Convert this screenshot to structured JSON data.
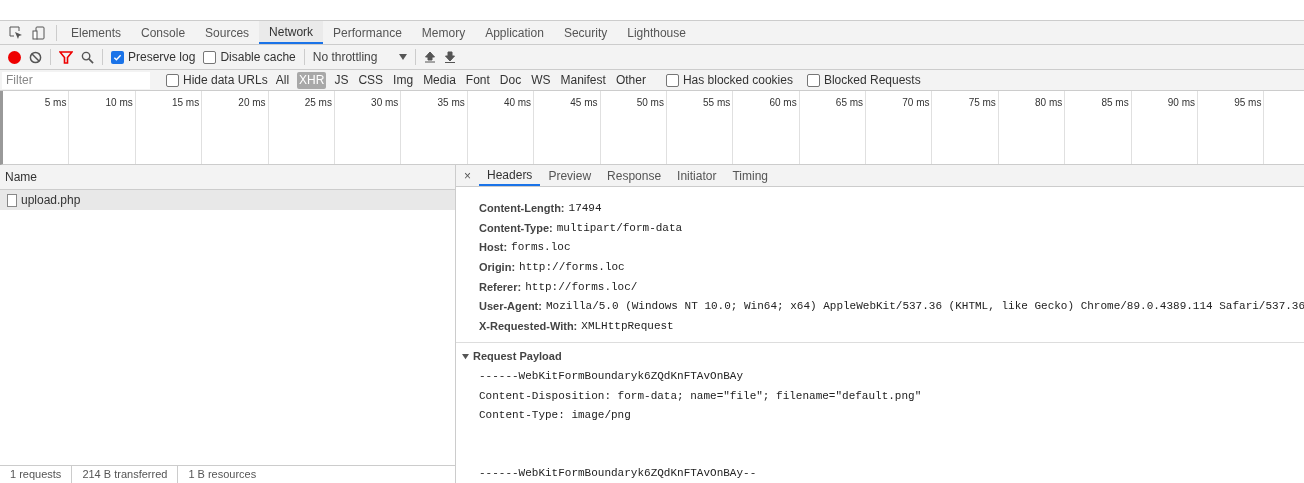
{
  "panel_tabs": [
    {
      "label": "Elements",
      "selected": false
    },
    {
      "label": "Console",
      "selected": false
    },
    {
      "label": "Sources",
      "selected": false
    },
    {
      "label": "Network",
      "selected": true
    },
    {
      "label": "Performance",
      "selected": false
    },
    {
      "label": "Memory",
      "selected": false
    },
    {
      "label": "Application",
      "selected": false
    },
    {
      "label": "Security",
      "selected": false
    },
    {
      "label": "Lighthouse",
      "selected": false
    }
  ],
  "toolbar": {
    "recording": true,
    "preserve_log": {
      "label": "Preserve log",
      "checked": true
    },
    "disable_cache": {
      "label": "Disable cache",
      "checked": false
    },
    "throttling": "No throttling"
  },
  "filter_bar": {
    "placeholder": "Filter",
    "hide_data_urls": {
      "label": "Hide data URLs",
      "checked": false
    },
    "types": [
      {
        "label": "All",
        "selected": false
      },
      {
        "label": "XHR",
        "selected": true
      },
      {
        "label": "JS",
        "selected": false
      },
      {
        "label": "CSS",
        "selected": false
      },
      {
        "label": "Img",
        "selected": false
      },
      {
        "label": "Media",
        "selected": false
      },
      {
        "label": "Font",
        "selected": false
      },
      {
        "label": "Doc",
        "selected": false
      },
      {
        "label": "WS",
        "selected": false
      },
      {
        "label": "Manifest",
        "selected": false
      },
      {
        "label": "Other",
        "selected": false
      }
    ],
    "has_blocked_cookies": {
      "label": "Has blocked cookies",
      "checked": false
    },
    "blocked_requests": {
      "label": "Blocked Requests",
      "checked": false
    }
  },
  "timeline": {
    "ticks": [
      "5 ms",
      "10 ms",
      "15 ms",
      "20 ms",
      "25 ms",
      "30 ms",
      "35 ms",
      "40 ms",
      "45 ms",
      "50 ms",
      "55 ms",
      "60 ms",
      "65 ms",
      "70 ms",
      "75 ms",
      "80 ms",
      "85 ms",
      "90 ms",
      "95 ms"
    ]
  },
  "requests": {
    "column": "Name",
    "rows": [
      {
        "name": "upload.php",
        "selected": true
      }
    ]
  },
  "details": {
    "close": "×",
    "tabs": [
      {
        "label": "Headers",
        "selected": true
      },
      {
        "label": "Preview",
        "selected": false
      },
      {
        "label": "Response",
        "selected": false
      },
      {
        "label": "Initiator",
        "selected": false
      },
      {
        "label": "Timing",
        "selected": false
      }
    ],
    "headers": [
      {
        "name": "Content-Length:",
        "value": "17494"
      },
      {
        "name": "Content-Type:",
        "value": "multipart/form-data"
      },
      {
        "name": "Host:",
        "value": "forms.loc"
      },
      {
        "name": "Origin:",
        "value": "http://forms.loc"
      },
      {
        "name": "Referer:",
        "value": "http://forms.loc/"
      },
      {
        "name": "User-Agent:",
        "value": "Mozilla/5.0 (Windows NT 10.0; Win64; x64) AppleWebKit/537.36 (KHTML, like Gecko) Chrome/89.0.4389.114 Safari/537.36"
      },
      {
        "name": "X-Requested-With:",
        "value": "XMLHttpRequest"
      }
    ],
    "payload": {
      "title": "Request Payload",
      "expanded": true,
      "lines": [
        {
          "text": "------WebKitFormBoundaryk6ZQdKnFTAvOnBAy",
          "spaced": false
        },
        {
          "text": "Content-Disposition: form-data; name=\"file\"; filename=\"default.png\"",
          "spaced": false
        },
        {
          "text": "Content-Type: image/png",
          "spaced": false
        },
        {
          "text": "------WebKitFormBoundaryk6ZQdKnFTAvOnBAy--",
          "spaced": true
        }
      ]
    }
  },
  "status_bar": [
    "1 requests",
    "214 B transferred",
    "1 B resources"
  ]
}
